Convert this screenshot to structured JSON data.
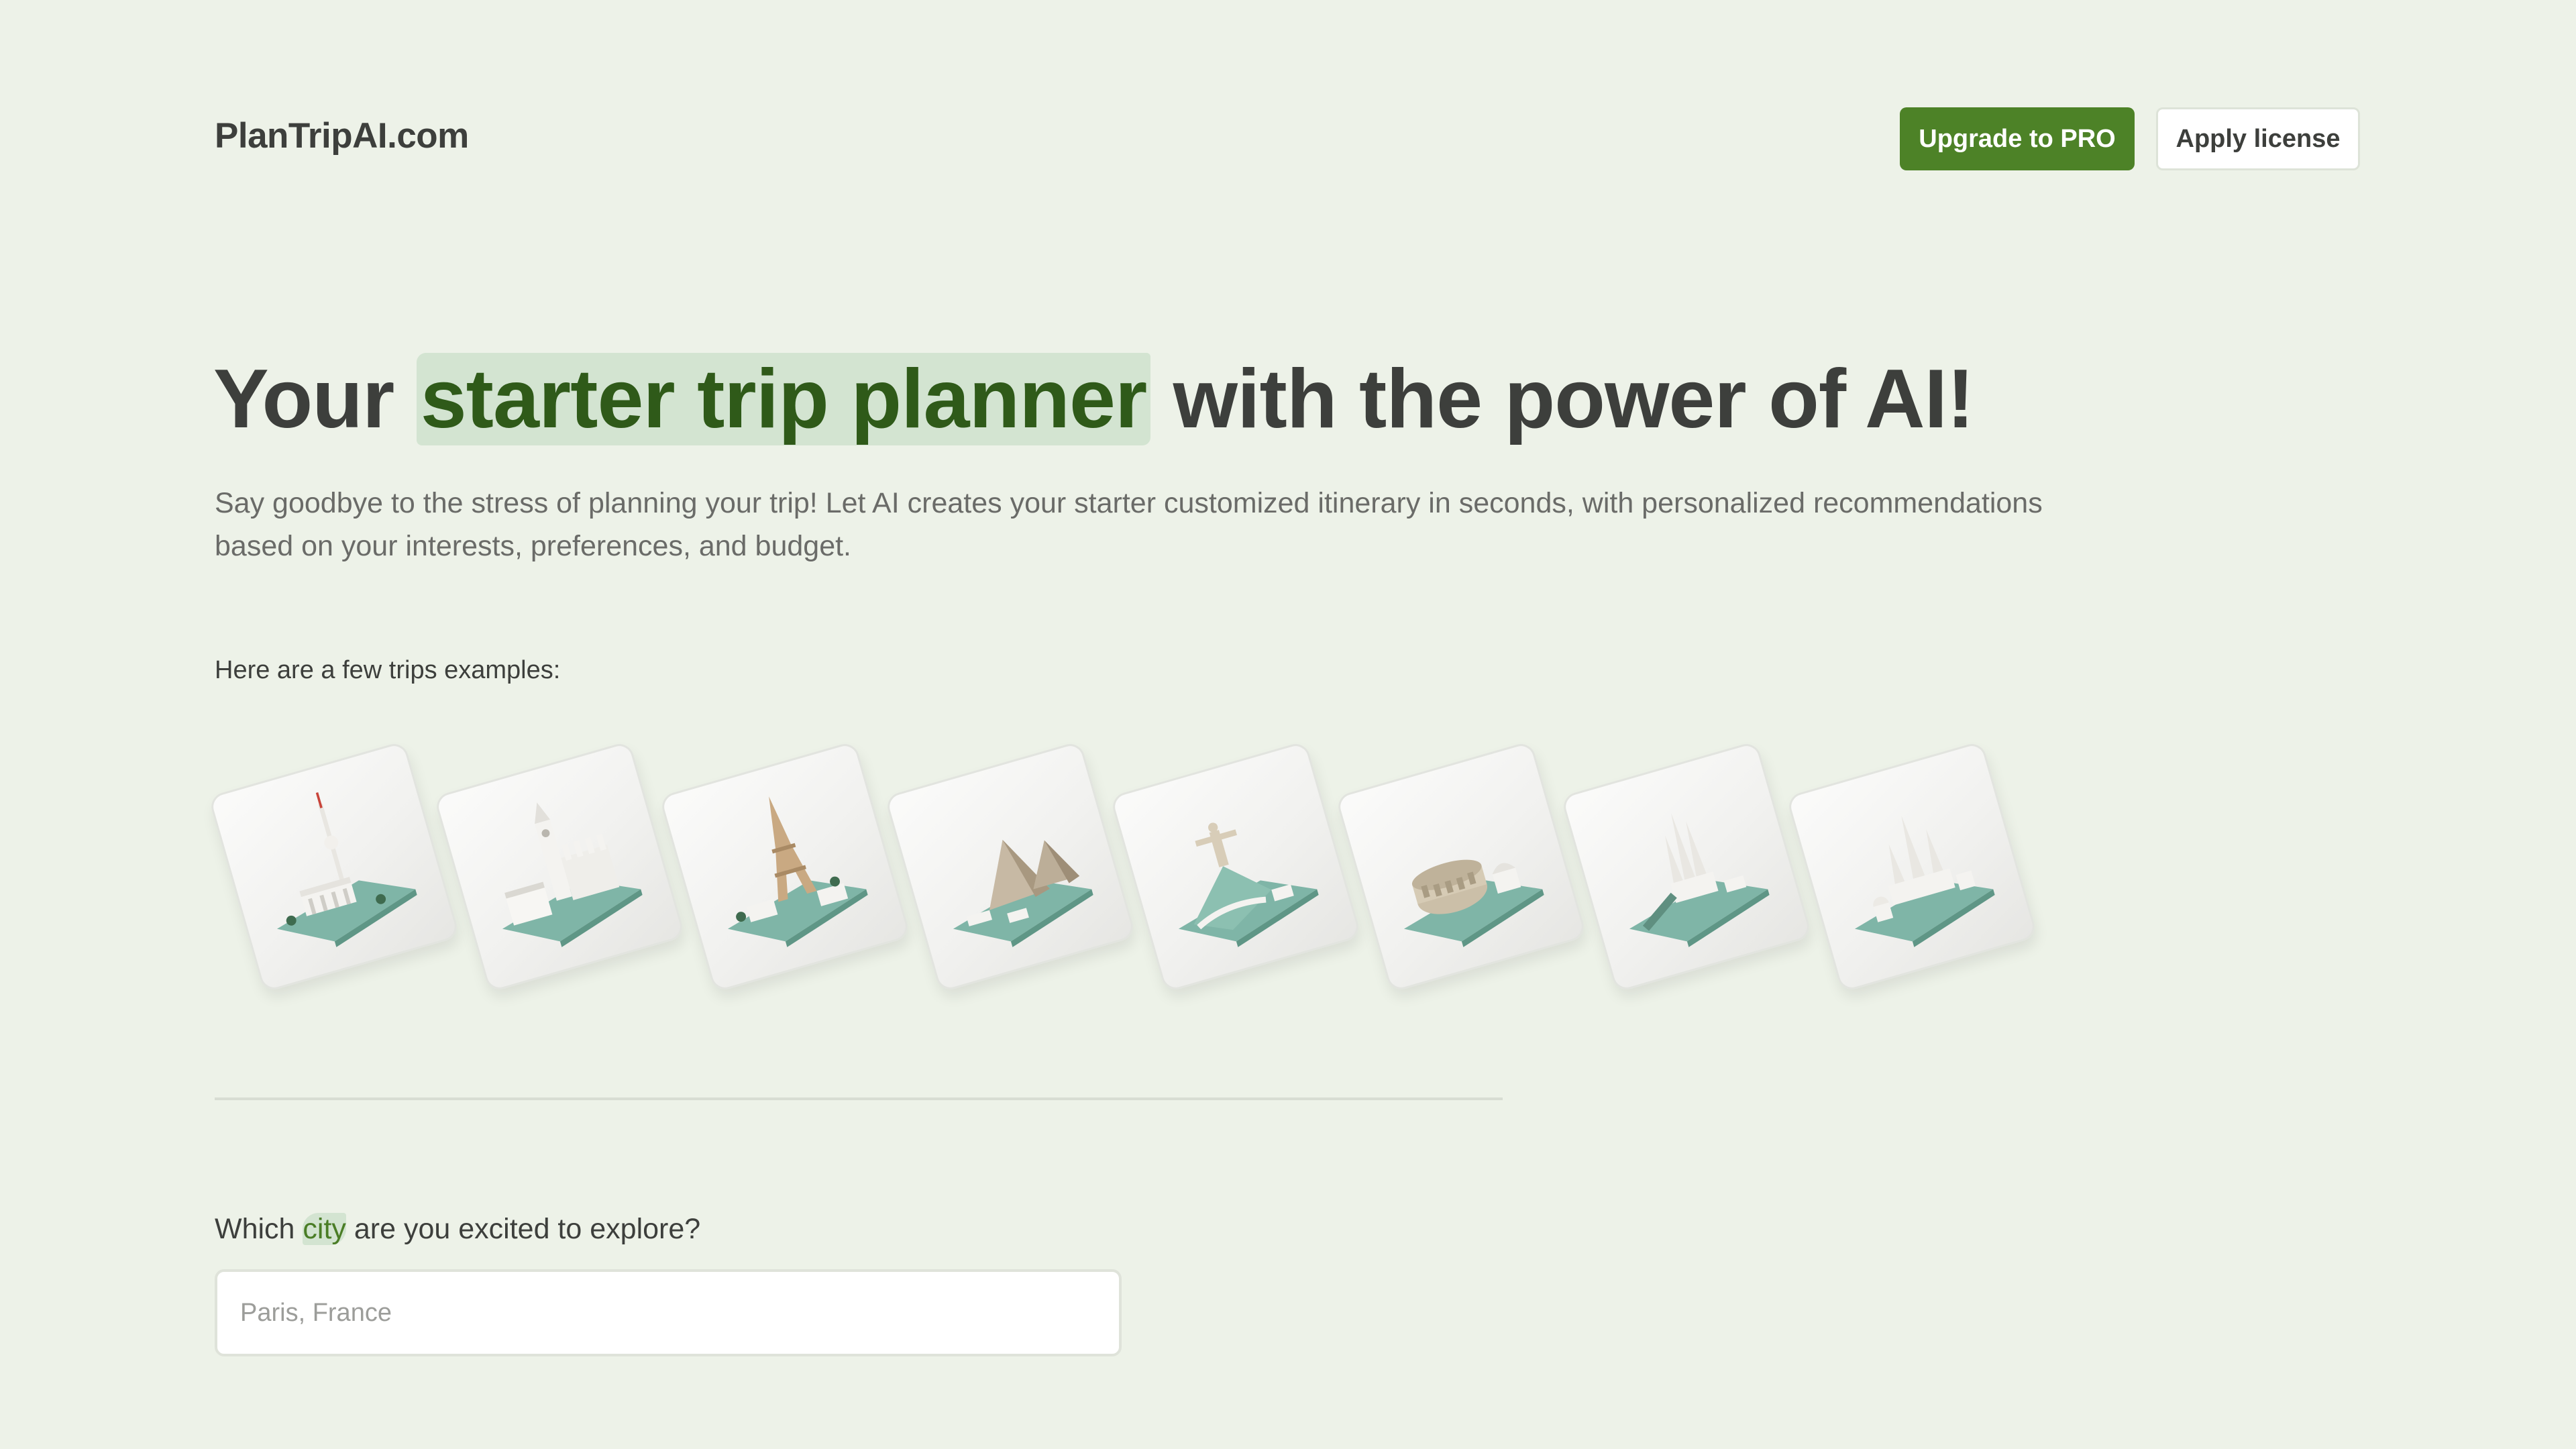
{
  "header": {
    "logo": "PlanTripAI.com",
    "upgrade_label": "Upgrade to PRO",
    "license_label": "Apply license"
  },
  "hero": {
    "title_start": "Your ",
    "title_highlight": "starter trip planner",
    "title_end": " with the power of AI!",
    "subtitle": "Say goodbye to the stress of planning your trip! Let AI creates your starter customized itinerary in seconds, with personalized recommendations based on your interests, preferences, and budget."
  },
  "examples": {
    "label": "Here are a few trips examples:",
    "cards": [
      {
        "landmark": "tv-tower-brandenburg-gate"
      },
      {
        "landmark": "big-ben-westminster"
      },
      {
        "landmark": "eiffel-tower"
      },
      {
        "landmark": "pyramids"
      },
      {
        "landmark": "christ-the-redeemer"
      },
      {
        "landmark": "colosseum"
      },
      {
        "landmark": "sagrada-familia"
      },
      {
        "landmark": "kremlin"
      }
    ]
  },
  "form": {
    "question_start": "Which ",
    "question_highlight": "city",
    "question_end": " are you excited to explore?",
    "city_placeholder": "Paris, France",
    "city_value": ""
  },
  "colors": {
    "background": "#edf2e8",
    "accent": "#4d8227",
    "highlight": "#d3e4d1",
    "highlight_text": "#2f5a19",
    "base_teal": "#7fb5a7"
  }
}
